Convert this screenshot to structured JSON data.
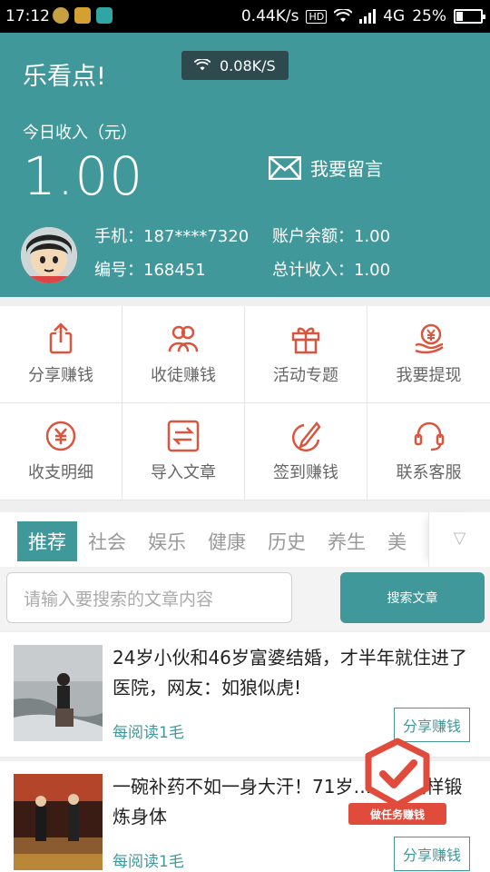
{
  "status_bar": {
    "time": "17:12",
    "network_speed": "0.44K/s",
    "hd_badge": "HD",
    "network_type": "4G",
    "battery_percent": "25%",
    "battery_level": 0.25
  },
  "header": {
    "app_title": "乐看点!",
    "speed_pill": "0.08K/S",
    "income_label": "今日收入（元）",
    "income_value": "1.00",
    "message_label": "我要留言",
    "phone": "手机：187****7320",
    "user_id": "编号：168451",
    "balance": "账户余额：1.00",
    "total_income": "总计收入：1.00"
  },
  "menu": {
    "items": [
      {
        "label": "分享赚钱",
        "icon": "share-icon"
      },
      {
        "label": "收徒赚钱",
        "icon": "users-icon"
      },
      {
        "label": "活动专题",
        "icon": "gift-icon"
      },
      {
        "label": "我要提现",
        "icon": "withdraw-icon"
      },
      {
        "label": "收支明细",
        "icon": "yuan-circle-icon"
      },
      {
        "label": "导入文章",
        "icon": "import-icon"
      },
      {
        "label": "签到赚钱",
        "icon": "checkin-icon"
      },
      {
        "label": "联系客服",
        "icon": "headset-icon"
      }
    ]
  },
  "tabs": {
    "items": [
      "推荐",
      "社会",
      "娱乐",
      "健康",
      "历史",
      "养生",
      "美"
    ],
    "active_index": 0,
    "more_icon": "▽"
  },
  "search": {
    "placeholder": "请输入要搜索的文章内容",
    "button_label": "搜索文章"
  },
  "articles": [
    {
      "title": "24岁小伙和46岁富婆结婚，才半年就住进了医院，网友：如狼似虎!",
      "reward": "每阅读1毛",
      "share_label": "分享赚钱"
    },
    {
      "title": "一碗补药不如一身大汗！71岁…每天这样锻炼身体",
      "reward": "每阅读1毛",
      "share_label": "分享赚钱"
    }
  ],
  "task_badge": {
    "label": "做任务赚钱"
  },
  "colors": {
    "primary": "#41989a",
    "icon_accent": "#d9553f",
    "badge_red": "#e14b3c"
  }
}
